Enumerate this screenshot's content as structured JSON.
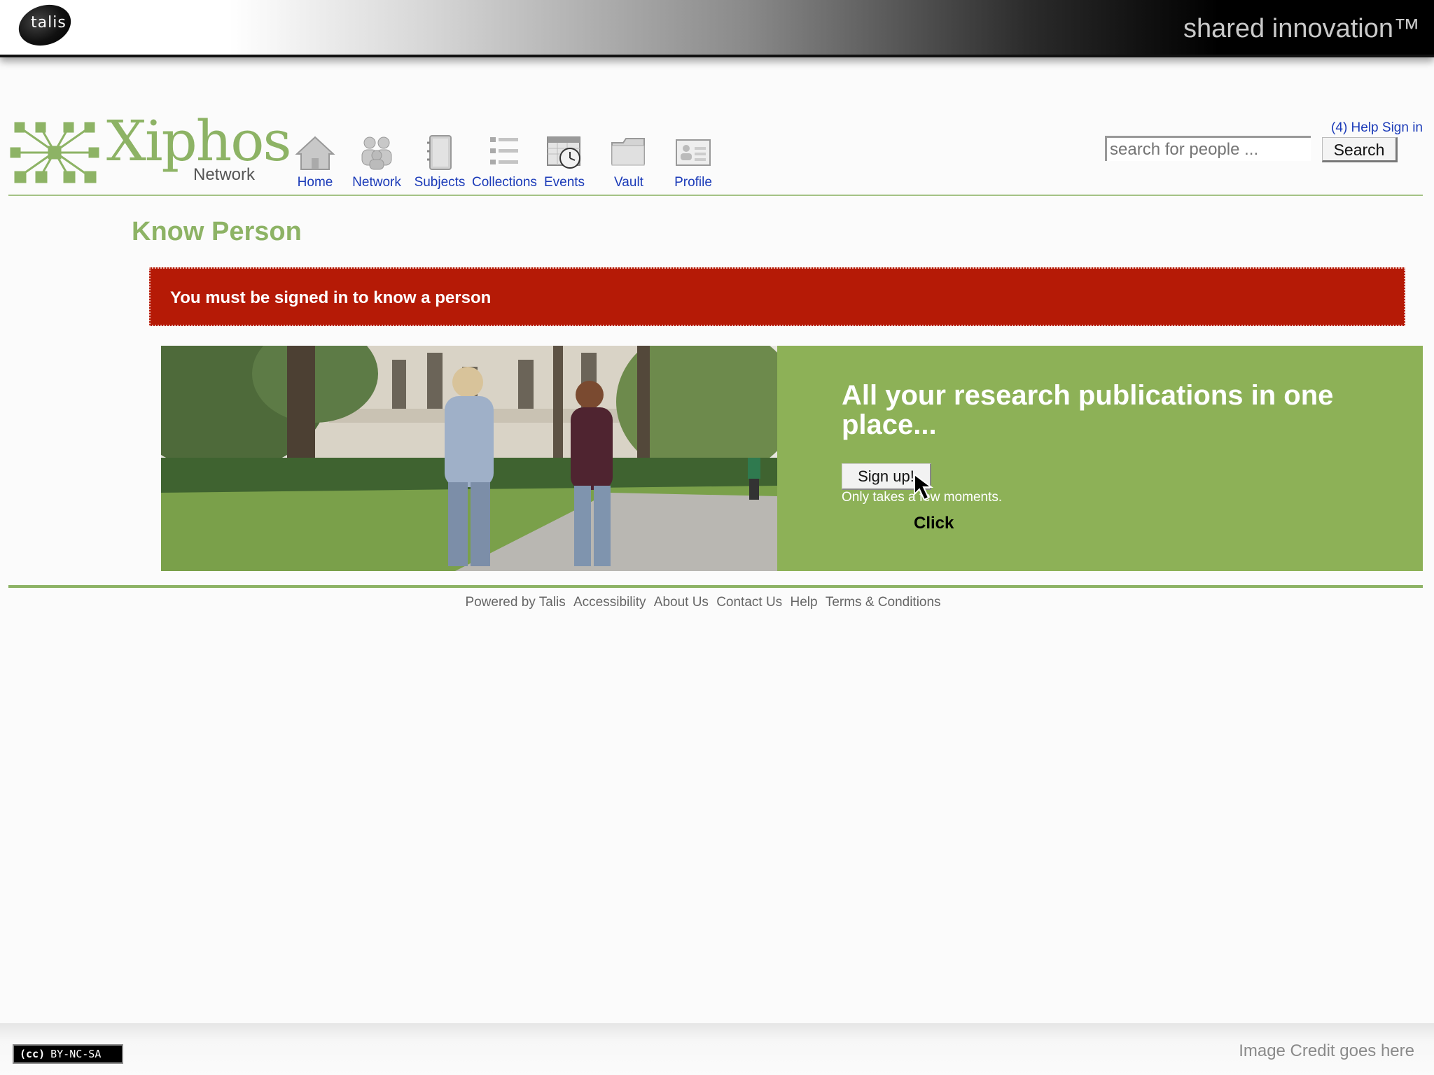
{
  "slide": {
    "logo_text": "talis",
    "tagline": "shared innovation™",
    "license_badge_icon": "(cc)",
    "license_badge_text": "BY-NC-SA",
    "image_credit": "Image Credit goes here"
  },
  "site": {
    "brand": "Xiphos",
    "brand_sub": "Network",
    "nav": [
      {
        "label": "Home",
        "icon": "home-icon"
      },
      {
        "label": "Network",
        "icon": "people-icon"
      },
      {
        "label": "Subjects",
        "icon": "notebook-icon"
      },
      {
        "label": "Collections",
        "icon": "list-icon"
      },
      {
        "label": "Events",
        "icon": "calendar-clock-icon"
      },
      {
        "label": "Vault",
        "icon": "folder-icon"
      },
      {
        "label": "Profile",
        "icon": "profile-card-icon"
      }
    ],
    "help_sign": "(4) Help Sign in",
    "search": {
      "placeholder": "search for people ...",
      "button": "Search"
    }
  },
  "page": {
    "title": "Know Person",
    "alert": "You must be signed in to know a person",
    "promo": {
      "headline": "All your research publications in one place...",
      "signup_button": "Sign up!",
      "signup_note": "Only takes a few moments."
    },
    "annotation": "Click"
  },
  "footer": {
    "links": [
      "Powered by Talis",
      "Accessibility",
      "About Us",
      "Contact Us",
      "Help",
      "Terms & Conditions"
    ]
  },
  "colors": {
    "brand_green": "#8db365",
    "promo_green": "#8db157",
    "alert_red": "#b51a06",
    "link_blue": "#1a3ab8"
  }
}
